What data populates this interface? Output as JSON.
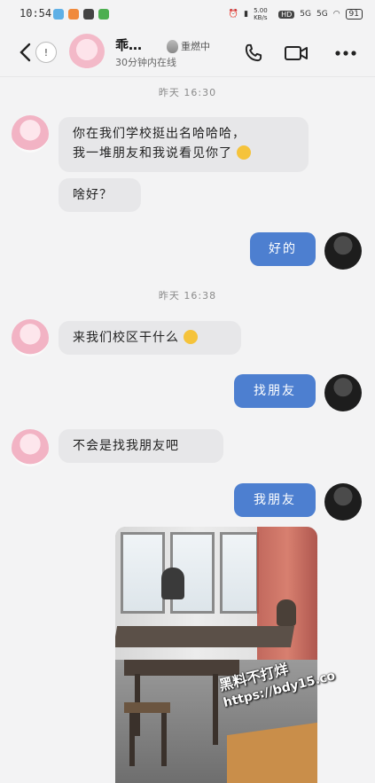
{
  "status_bar": {
    "time": "10:54",
    "network_speed": "5.00 KB/s",
    "hd_label": "HD",
    "signal1": "5G",
    "signal2": "5G",
    "battery": "91"
  },
  "header": {
    "unread_count": "!",
    "contact_name": "乖…",
    "flame_text": "重燃中",
    "online_status": "30分钟内在线"
  },
  "messages": {
    "ts1": "昨天 16:30",
    "msg1_line1": "你在我们学校挺出名哈哈哈，",
    "msg1_line2": "我一堆朋友和我说看见你了",
    "msg2": "啥好？",
    "msg3": "好的",
    "ts2": "昨天 16:38",
    "msg4": "来我们校区干什么",
    "msg5": "找朋友",
    "msg6": "不会是找我朋友吧",
    "msg7": "我朋友"
  },
  "photo_watermark": {
    "line1": "黑料不打烊",
    "line2": "https://bdy15.co"
  },
  "colors": {
    "self_bubble": "#4d7fd0",
    "other_bubble": "#e7e7e9",
    "background": "#f3f3f4"
  }
}
